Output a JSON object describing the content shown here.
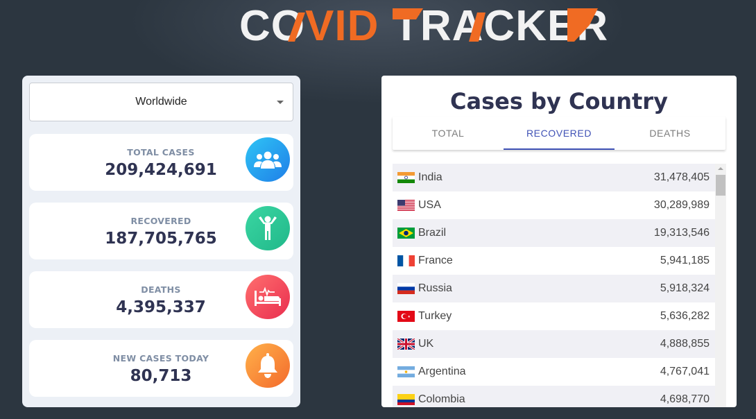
{
  "header": {
    "logo_text": "COVID TRACKER",
    "accent_color": "#f06b23"
  },
  "region_select": {
    "selected": "Worldwide"
  },
  "stats": [
    {
      "label": "TOTAL CASES",
      "value": "209,424,691",
      "icon": "people-icon",
      "color": "#1f7fe8"
    },
    {
      "label": "RECOVERED",
      "value": "187,705,765",
      "icon": "person-arms-up-icon",
      "color": "#21b88a"
    },
    {
      "label": "DEATHS",
      "value": "4,395,337",
      "icon": "hospital-bed-icon",
      "color": "#e92e4e"
    },
    {
      "label": "NEW CASES TODAY",
      "value": "80,713",
      "icon": "bell-icon",
      "color": "#f36a2c"
    }
  ],
  "country_panel": {
    "title": "Cases by Country",
    "tabs": [
      "TOTAL",
      "RECOVERED",
      "DEATHS"
    ],
    "active_tab": "RECOVERED",
    "rows": [
      {
        "flag": "india-flag-icon",
        "name": "India",
        "value": "31,478,405"
      },
      {
        "flag": "usa-flag-icon",
        "name": "USA",
        "value": "30,289,989"
      },
      {
        "flag": "brazil-flag-icon",
        "name": "Brazil",
        "value": "19,313,546"
      },
      {
        "flag": "france-flag-icon",
        "name": "France",
        "value": "5,941,185"
      },
      {
        "flag": "russia-flag-icon",
        "name": "Russia",
        "value": "5,918,324"
      },
      {
        "flag": "turkey-flag-icon",
        "name": "Turkey",
        "value": "5,636,282"
      },
      {
        "flag": "uk-flag-icon",
        "name": "UK",
        "value": "4,888,855"
      },
      {
        "flag": "argentina-flag-icon",
        "name": "Argentina",
        "value": "4,767,041"
      },
      {
        "flag": "colombia-flag-icon",
        "name": "Colombia",
        "value": "4,698,770"
      }
    ]
  }
}
